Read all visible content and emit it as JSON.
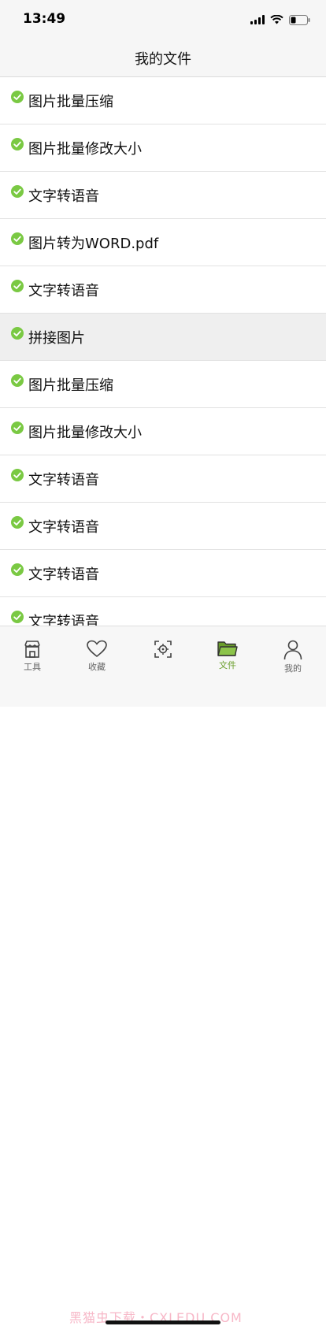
{
  "status_bar": {
    "time": "13:49"
  },
  "nav": {
    "title": "我的文件"
  },
  "files": [
    {
      "name": "图片批量压缩",
      "highlight": false
    },
    {
      "name": "图片批量修改大小",
      "highlight": false
    },
    {
      "name": "文字转语音",
      "highlight": false
    },
    {
      "name": "图片转为WORD.pdf",
      "highlight": false
    },
    {
      "name": "文字转语音",
      "highlight": false
    },
    {
      "name": "拼接图片",
      "highlight": true
    },
    {
      "name": "图片批量压缩",
      "highlight": false
    },
    {
      "name": "图片批量修改大小",
      "highlight": false
    },
    {
      "name": "文字转语音",
      "highlight": false
    },
    {
      "name": "文字转语音",
      "highlight": false
    },
    {
      "name": "文字转语音",
      "highlight": false
    },
    {
      "name": "文字转语音",
      "highlight": false
    }
  ],
  "tabs": [
    {
      "label": "工具",
      "icon": "shop-icon",
      "active": false
    },
    {
      "label": "收藏",
      "icon": "heart-icon",
      "active": false
    },
    {
      "label": "",
      "icon": "scan-icon",
      "active": false
    },
    {
      "label": "文件",
      "icon": "folder-icon",
      "active": true
    },
    {
      "label": "我的",
      "icon": "user-icon",
      "active": false
    }
  ],
  "watermark": "黑猫虫下载・CXLEDU.COM",
  "colors": {
    "check": "#7ac943",
    "active_tab": "#6a9e2b",
    "highlight_row": "#efefef"
  }
}
